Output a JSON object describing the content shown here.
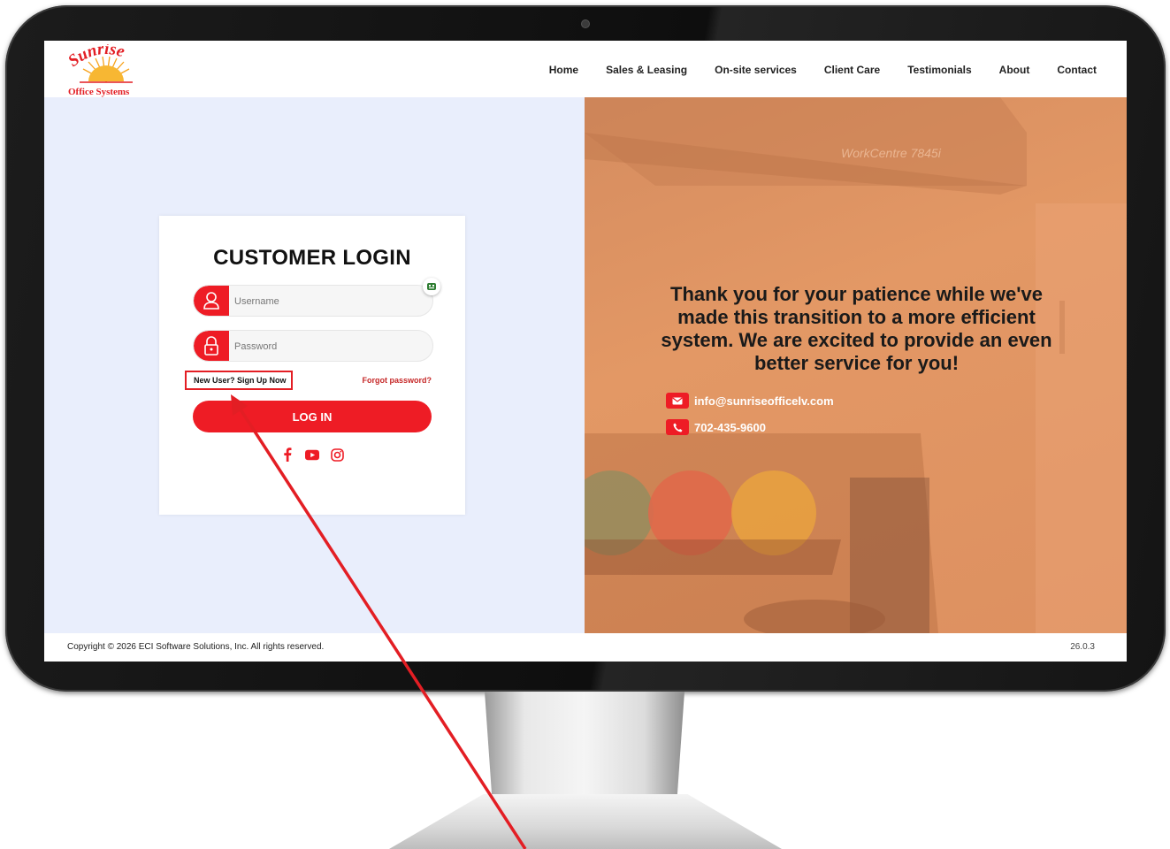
{
  "header": {
    "logo_word": "Sunrise",
    "logo_sub": "Office Systems",
    "nav": [
      "Home",
      "Sales & Leasing",
      "On-site services",
      "Client Care",
      "Testimonials",
      "About",
      "Contact"
    ]
  },
  "login": {
    "title": "CUSTOMER LOGIN",
    "username_placeholder": "Username",
    "password_placeholder": "Password",
    "signup_link": "New User? Sign Up Now",
    "forgot_link": "Forgot password?",
    "login_button": "LOG IN",
    "social_icons": [
      "facebook-icon",
      "youtube-icon",
      "instagram-icon"
    ]
  },
  "promo": {
    "message": "Thank you for your patience while we've made this transition to a more efficient system. We are excited to provide an even better service for you!",
    "email": "info@sunriseofficelv.com",
    "phone": "702-435-9600",
    "device_label": "WorkCentre 7845i"
  },
  "footer": {
    "copyright": "Copyright © 2026 ECI Software Solutions, Inc. All rights reserved.",
    "version": "26.0.3"
  },
  "colors": {
    "accent": "#ee1c25",
    "left_bg": "#e9eefc",
    "promo_bg": "#e39865"
  }
}
